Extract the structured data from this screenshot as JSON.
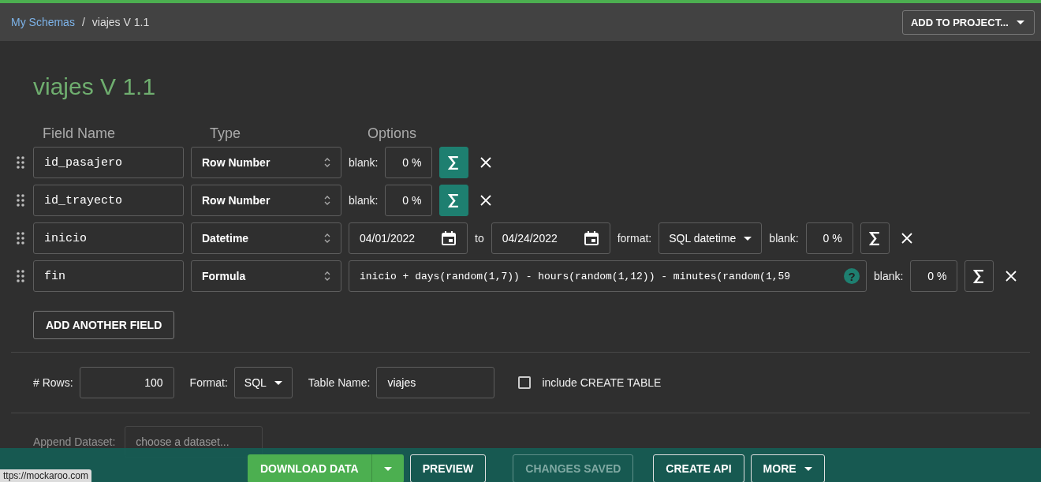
{
  "breadcrumb": {
    "link": "My Schemas",
    "separator": "/",
    "current": "viajes V 1.1"
  },
  "add_to_project": {
    "label": "ADD TO PROJECT..."
  },
  "title": "viajes V 1.1",
  "columns": [
    "Field Name",
    "Type",
    "Options"
  ],
  "fields": [
    {
      "name": "id_pasajero",
      "type": "Row Number",
      "kind": "blank",
      "blank_label": "blank:",
      "blank": "0 %",
      "sigma_active": true
    },
    {
      "name": "id_trayecto",
      "type": "Row Number",
      "kind": "blank",
      "blank_label": "blank:",
      "blank": "0 %",
      "sigma_active": true
    },
    {
      "name": "inicio",
      "type": "Datetime",
      "kind": "datetime",
      "from": "04/01/2022",
      "to_label": "to",
      "to": "04/24/2022",
      "format_label": "format:",
      "format": "SQL datetime",
      "blank_label": "blank:",
      "blank": "0 %",
      "sigma_active": false
    },
    {
      "name": "fin",
      "type": "Formula",
      "kind": "formula",
      "formula": "inicio + days(random(1,7)) - hours(random(1,12)) - minutes(random(1,59",
      "help": "?",
      "blank_label": "blank:",
      "blank": "0 %",
      "sigma_active": false
    }
  ],
  "add_field": "ADD ANOTHER FIELD",
  "settings": {
    "rows_label": "# Rows:",
    "rows": "100",
    "format_label": "Format:",
    "format": "SQL",
    "table_label": "Table Name:",
    "table": "viajes",
    "create_table_label": "include CREATE TABLE",
    "create_table": false
  },
  "append": {
    "label": "Append Dataset:",
    "placeholder": "choose a dataset..."
  },
  "footer": [
    {
      "label": "DOWNLOAD DATA",
      "kind": "primary"
    },
    {
      "label": "PREVIEW",
      "kind": "outline",
      "disabled": false
    },
    {
      "label": "CHANGES SAVED",
      "kind": "outline",
      "disabled": true
    },
    {
      "label": "CREATE API",
      "kind": "outline",
      "disabled": false
    },
    {
      "label": "MORE",
      "kind": "menu",
      "disabled": false
    }
  ],
  "status_url": "ttps://mockaroo.com"
}
